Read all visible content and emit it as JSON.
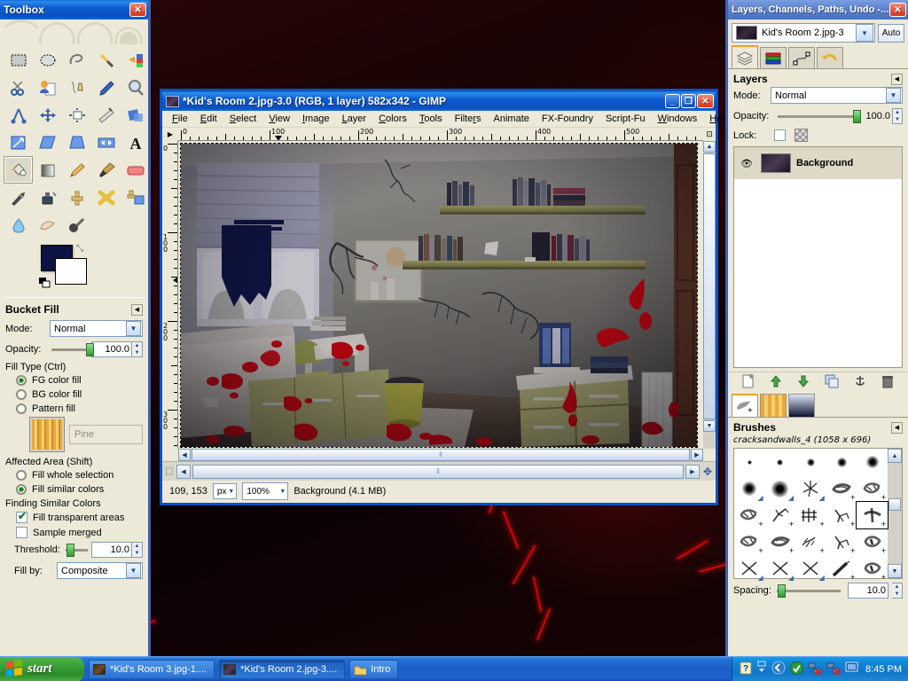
{
  "desktop": {
    "wallpaper_desc": "dark red cracked wall"
  },
  "toolbox": {
    "title": "Toolbox",
    "close_label": "✕",
    "tools": [
      {
        "name": "rect-select-tool",
        "glyph": "▭"
      },
      {
        "name": "ellipse-select-tool",
        "glyph": "⬭"
      },
      {
        "name": "free-select-tool",
        "glyph": "◠"
      },
      {
        "name": "fuzzy-select-tool",
        "glyph": "✦"
      },
      {
        "name": "select-by-color-tool",
        "glyph": "▥"
      },
      {
        "name": "scissors-select-tool",
        "glyph": "✂"
      },
      {
        "name": "foreground-select-tool",
        "glyph": "☰"
      },
      {
        "name": "paths-tool",
        "glyph": "✒"
      },
      {
        "name": "color-picker-tool",
        "glyph": "⟋"
      },
      {
        "name": "zoom-tool",
        "glyph": "🔍"
      },
      {
        "name": "measure-tool",
        "glyph": "⊿"
      },
      {
        "name": "move-tool",
        "glyph": "✥"
      },
      {
        "name": "alignment-tool",
        "glyph": "⊞"
      },
      {
        "name": "crop-tool",
        "glyph": "⌗"
      },
      {
        "name": "rotate-tool",
        "glyph": "◈"
      },
      {
        "name": "scale-tool",
        "glyph": "⤢"
      },
      {
        "name": "shear-tool",
        "glyph": "▰"
      },
      {
        "name": "perspective-tool",
        "glyph": "▱"
      },
      {
        "name": "flip-tool",
        "glyph": "⇔"
      },
      {
        "name": "text-tool",
        "glyph": "A"
      },
      {
        "name": "bucket-fill-tool",
        "glyph": "◐"
      },
      {
        "name": "blend-tool",
        "glyph": "▦"
      },
      {
        "name": "pencil-tool",
        "glyph": "✏"
      },
      {
        "name": "paintbrush-tool",
        "glyph": "🖌"
      },
      {
        "name": "eraser-tool",
        "glyph": "▬"
      },
      {
        "name": "airbrush-tool",
        "glyph": "⌁"
      },
      {
        "name": "ink-tool",
        "glyph": "⬓"
      },
      {
        "name": "clone-tool",
        "glyph": "⚲"
      },
      {
        "name": "heal-tool",
        "glyph": "✚"
      },
      {
        "name": "perspective-clone-tool",
        "glyph": "⬔"
      },
      {
        "name": "blur-sharpen-tool",
        "glyph": "💧"
      },
      {
        "name": "smudge-tool",
        "glyph": "☁"
      },
      {
        "name": "dodge-burn-tool",
        "glyph": "◕"
      }
    ],
    "active_tool_index": 20,
    "fg_color": "#0b1345",
    "bg_color": "#ffffff"
  },
  "tool_options": {
    "title": "Bucket Fill",
    "mode_label": "Mode:",
    "mode_value": "Normal",
    "opacity_label": "Opacity:",
    "opacity_value": "100.0",
    "fill_type_label": "Fill Type  (Ctrl)",
    "fill_type_options": [
      {
        "label": "FG color fill",
        "selected": true
      },
      {
        "label": "BG color fill",
        "selected": false
      },
      {
        "label": "Pattern fill",
        "selected": false
      }
    ],
    "pattern_name": "Pine",
    "affected_area_label": "Affected Area  (Shift)",
    "affected_area_options": [
      {
        "label": "Fill whole selection",
        "selected": false
      },
      {
        "label": "Fill similar colors",
        "selected": true
      }
    ],
    "finding_label": "Finding Similar Colors",
    "checks": [
      {
        "label": "Fill transparent areas",
        "checked": true
      },
      {
        "label": "Sample merged",
        "checked": false
      }
    ],
    "threshold_label": "Threshold:",
    "threshold_value": "10.0",
    "fill_by_label": "Fill by:",
    "fill_by_value": "Composite"
  },
  "image_window": {
    "title": "*Kid's Room 2.jpg-3.0 (RGB, 1 layer) 582x342 - GIMP",
    "minimize_label": "_",
    "maximize_label": "❐",
    "close_label": "✕",
    "menu": [
      {
        "label": "File",
        "mn": "F"
      },
      {
        "label": "Edit",
        "mn": "E"
      },
      {
        "label": "Select",
        "mn": "S"
      },
      {
        "label": "View",
        "mn": "V"
      },
      {
        "label": "Image",
        "mn": "I"
      },
      {
        "label": "Layer",
        "mn": "L"
      },
      {
        "label": "Colors",
        "mn": "C"
      },
      {
        "label": "Tools",
        "mn": "T"
      },
      {
        "label": "Filters",
        "mn": "r"
      },
      {
        "label": "Animate",
        "mn": ""
      },
      {
        "label": "FX-Foundry",
        "mn": ""
      },
      {
        "label": "Script-Fu",
        "mn": ""
      },
      {
        "label": "Windows",
        "mn": "W"
      },
      {
        "label": "Help",
        "mn": "H"
      }
    ],
    "ruler_h_labels": [
      "0",
      "100",
      "200",
      "300",
      "400",
      "500"
    ],
    "ruler_v_labels": [
      "0",
      "100",
      "200",
      "300"
    ],
    "status": {
      "pointer_position": "109, 153",
      "unit": "px",
      "zoom": "100%",
      "layer_info": "Background (4.1 MB)"
    }
  },
  "dock": {
    "title": "Layers, Channels, Paths, Undo -...",
    "close_label": "✕",
    "image_name": "Kid's Room 2.jpg-3",
    "auto_label": "Auto",
    "tabs": [
      {
        "name": "layers-tab",
        "glyph": "▤"
      },
      {
        "name": "channels-tab",
        "glyph": "▦"
      },
      {
        "name": "paths-tab",
        "glyph": "✧"
      },
      {
        "name": "undo-history-tab",
        "glyph": "↺"
      }
    ],
    "layers_panel": {
      "title": "Layers",
      "mode_label": "Mode:",
      "mode_value": "Normal",
      "opacity_label": "Opacity:",
      "opacity_value": "100.0",
      "lock_label": "Lock:",
      "layers": [
        {
          "name": "Background",
          "visible": true,
          "selected": true
        }
      ],
      "buttons": [
        {
          "name": "new-layer-button",
          "glyph": "🗋"
        },
        {
          "name": "raise-layer-button",
          "glyph": "⬆"
        },
        {
          "name": "lower-layer-button",
          "glyph": "⬇"
        },
        {
          "name": "duplicate-layer-button",
          "glyph": "❐"
        },
        {
          "name": "anchor-layer-button",
          "glyph": "⚓"
        },
        {
          "name": "delete-layer-button",
          "glyph": "🗑"
        }
      ]
    },
    "brush_dock_tabs": [
      {
        "name": "brushes-tab",
        "selected": true
      },
      {
        "name": "patterns-tab",
        "selected": false
      },
      {
        "name": "gradients-tab",
        "selected": false
      }
    ],
    "brushes_panel": {
      "title": "Brushes",
      "current_brush": "cracksandwalls_4 (1058 x 696)",
      "spacing_label": "Spacing:",
      "spacing_value": "10.0",
      "selected_index": 14,
      "cells": [
        {
          "size": 5,
          "mark": ""
        },
        {
          "size": 7,
          "mark": ""
        },
        {
          "size": 9,
          "mark": ""
        },
        {
          "size": 11,
          "mark": ""
        },
        {
          "size": 14,
          "mark": ""
        },
        {
          "size": 16,
          "mark": "◢"
        },
        {
          "size": 19,
          "mark": "◢"
        },
        {
          "size": 0,
          "mark": "◢"
        },
        {
          "size": 0,
          "mark": "+"
        },
        {
          "size": 0,
          "mark": "+"
        },
        {
          "size": 0,
          "mark": "+"
        },
        {
          "size": 0,
          "mark": "+"
        },
        {
          "size": 0,
          "mark": "+"
        },
        {
          "size": 0,
          "mark": "+"
        },
        {
          "size": 0,
          "mark": "+"
        },
        {
          "size": 0,
          "mark": "+"
        },
        {
          "size": 0,
          "mark": "+"
        },
        {
          "size": 0,
          "mark": "+"
        },
        {
          "size": 0,
          "mark": "+"
        },
        {
          "size": 0,
          "mark": "+"
        },
        {
          "size": 0,
          "mark": "◢"
        },
        {
          "size": 0,
          "mark": "◢"
        },
        {
          "size": 0,
          "mark": "◢"
        },
        {
          "size": 0,
          "mark": "+"
        },
        {
          "size": 0,
          "mark": "+"
        }
      ]
    }
  },
  "taskbar": {
    "start_label": "start",
    "items": [
      {
        "label": "*Kid's Room 3.jpg-1....",
        "active": false
      },
      {
        "label": "*Kid's Room 2.jpg-3....",
        "active": true
      },
      {
        "label": "Intro",
        "active": false
      }
    ],
    "tray": {
      "icons": [
        "help-icon",
        "show-desktop-icon",
        "back-icon",
        "shield-icon",
        "network-error-icon",
        "network-error2-icon",
        "display-icon"
      ],
      "clock": "8:45 PM"
    }
  }
}
